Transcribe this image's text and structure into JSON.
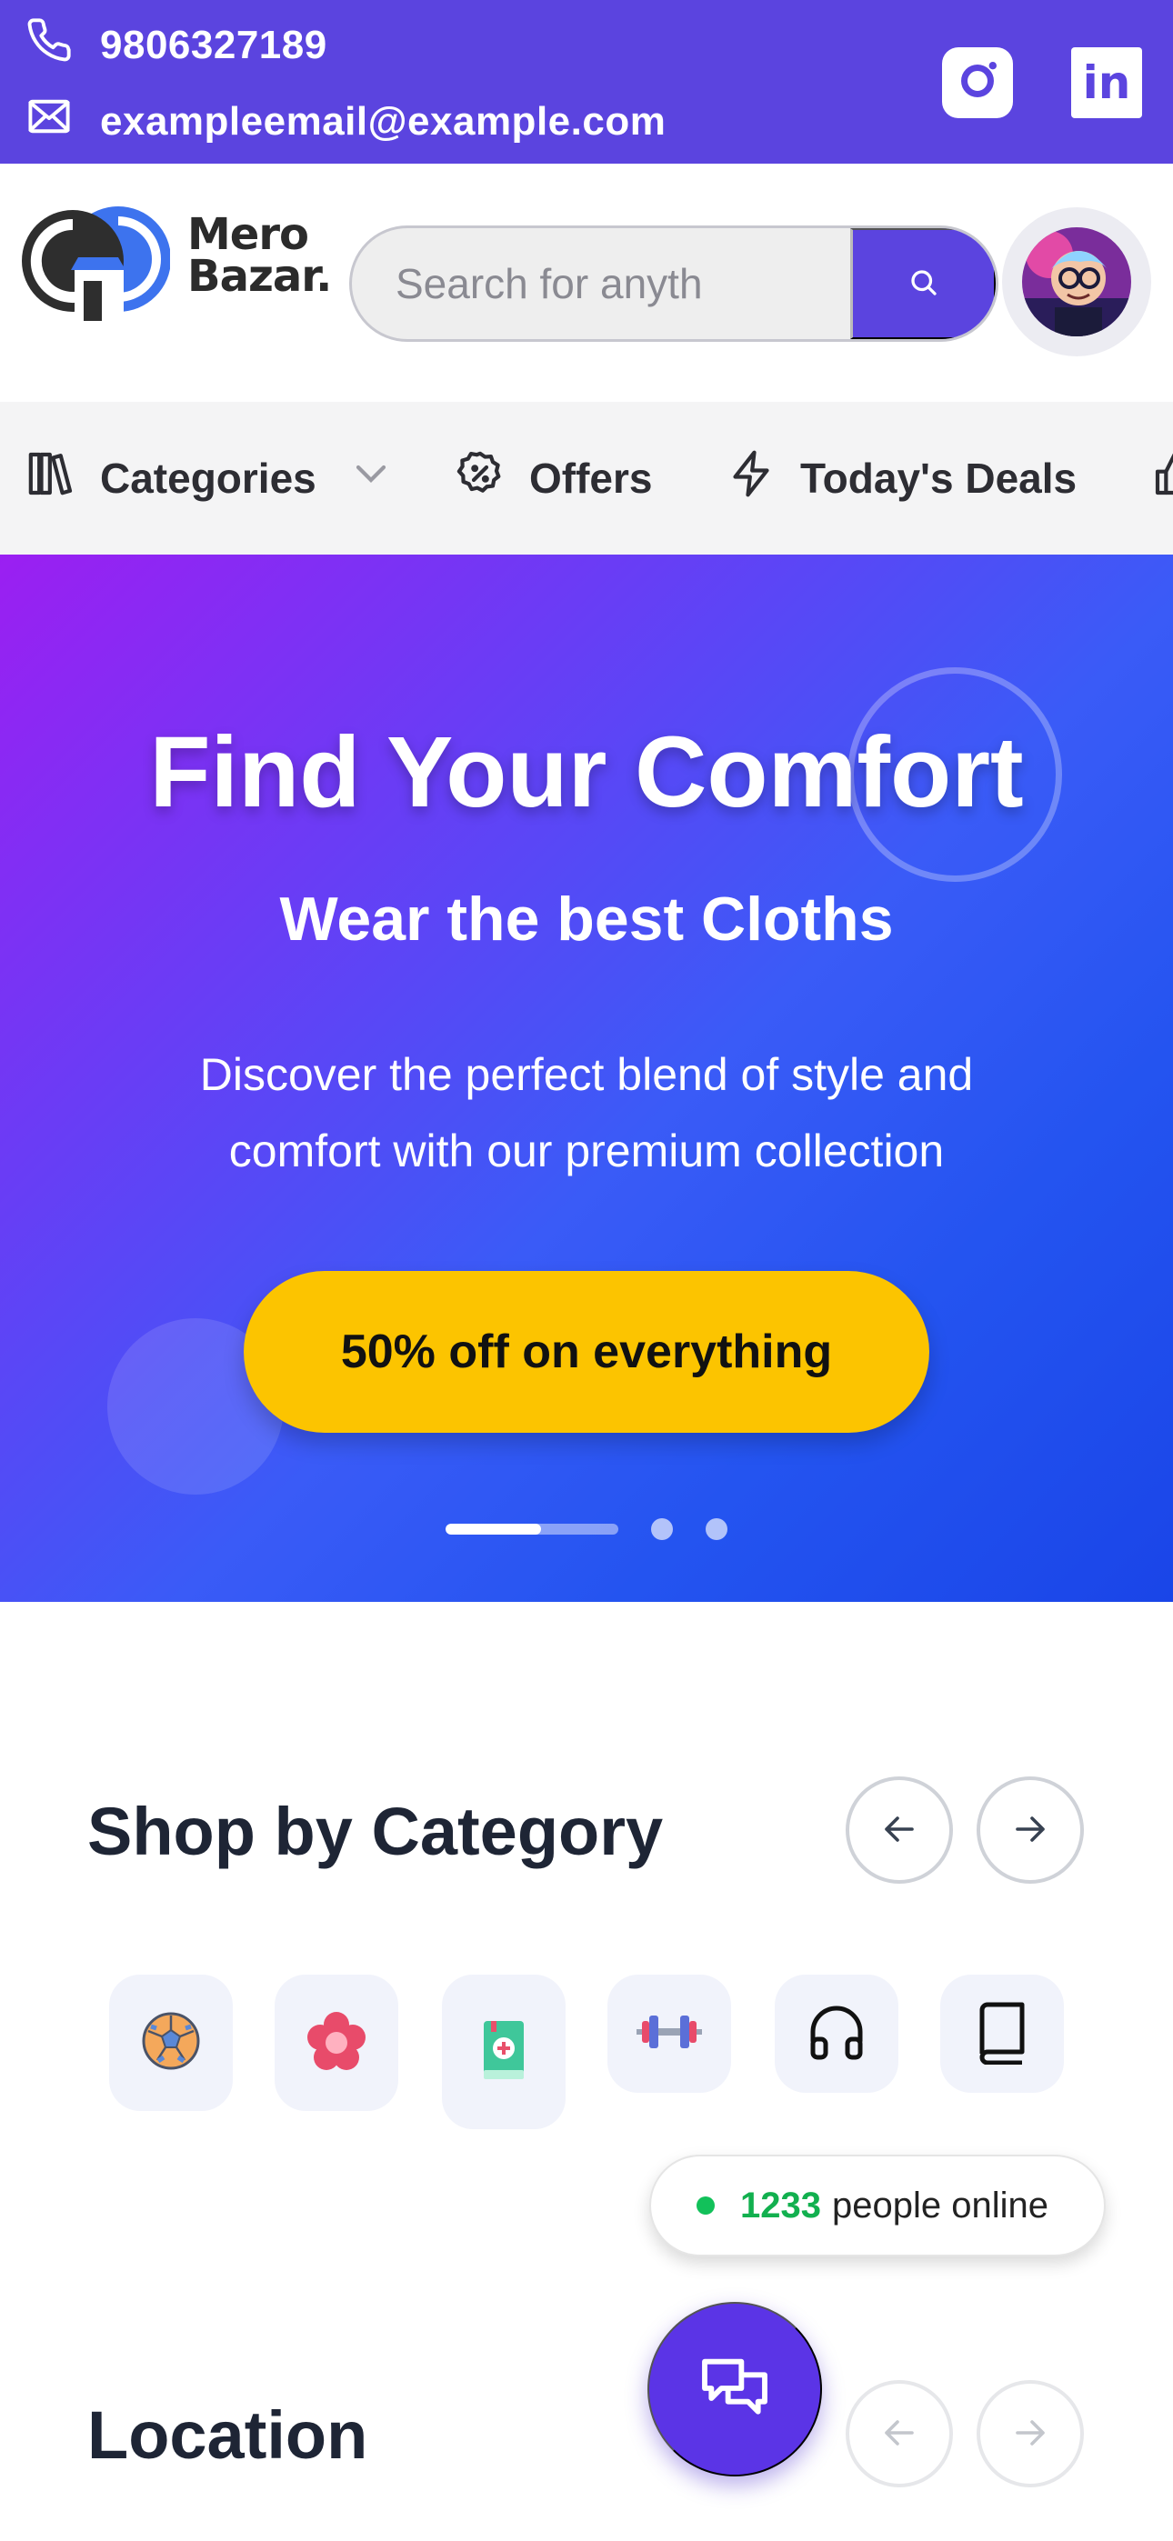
{
  "topbar": {
    "phone": "9806327189",
    "email": "exampleemail@example.com",
    "social_icons": [
      "instagram-icon",
      "linkedin-icon"
    ],
    "linkedin_text": "in"
  },
  "header": {
    "logo_line1": "Mero",
    "logo_line2": "Bazar.",
    "search_placeholder": "Search for anyth",
    "search_icon": "search-icon",
    "avatar": "user-avatar"
  },
  "nav": {
    "items": [
      {
        "label": "Categories",
        "icon": "library-icon",
        "has_dropdown": true
      },
      {
        "label": "Offers",
        "icon": "discount-badge-icon"
      },
      {
        "label": "Today's Deals",
        "icon": "lightning-icon"
      }
    ]
  },
  "hero": {
    "title": "Find Your Comfort",
    "subtitle": "Wear the best Cloths",
    "description": "Discover the perfect blend of style and comfort with our premium collection",
    "cta_label": "50% off on everything",
    "slide_progress": 0.55,
    "slides_count": 3
  },
  "categories": {
    "title": "Shop by Category",
    "items": [
      "football-icon",
      "flower-icon",
      "medical-book-icon",
      "dumbbell-icon",
      "headphones-icon",
      "book-icon"
    ]
  },
  "online": {
    "count": "1233",
    "label": "people online"
  },
  "location": {
    "title": "Location"
  },
  "colors": {
    "brand": "#5b44df",
    "cta": "#fcc400",
    "online_green": "#12c15a"
  }
}
